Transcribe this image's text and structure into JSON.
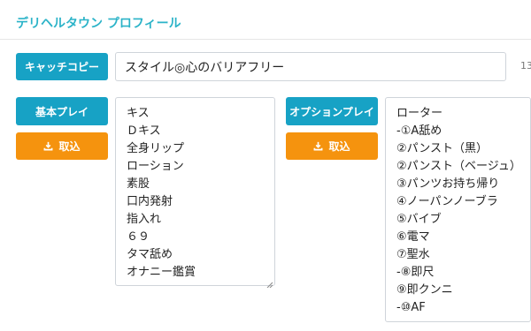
{
  "title": "デリヘルタウン プロフィール",
  "catch_copy": {
    "label": "キャッチコピー",
    "value": "スタイル◎心のバリアフリー",
    "counter": "13"
  },
  "basic_play": {
    "label": "基本プレイ",
    "import_label": "取込",
    "items": [
      "キス",
      "Ｄキス",
      "全身リップ",
      "ローション",
      "素股",
      "口内発射",
      "指入れ",
      "６９",
      "タマ舐め",
      "オナニー鑑賞"
    ]
  },
  "option_play": {
    "label": "オプションプレイ",
    "import_label": "取込",
    "items": [
      "ローター",
      "-①A舐め",
      "②パンスト（黒）",
      "②パンスト（ベージュ）",
      "③パンツお持ち帰り",
      "④ノーパンノーブラ",
      "⑤バイブ",
      "⑥電マ",
      "⑦聖水",
      "-⑧即尺",
      "⑨即クンニ",
      "-⑩AF"
    ]
  },
  "colors": {
    "accent": "#17a2c5",
    "import": "#f5930e",
    "title": "#2bb3c8"
  },
  "icons": {
    "import": "download-icon",
    "resize": "resize-handle-icon"
  }
}
